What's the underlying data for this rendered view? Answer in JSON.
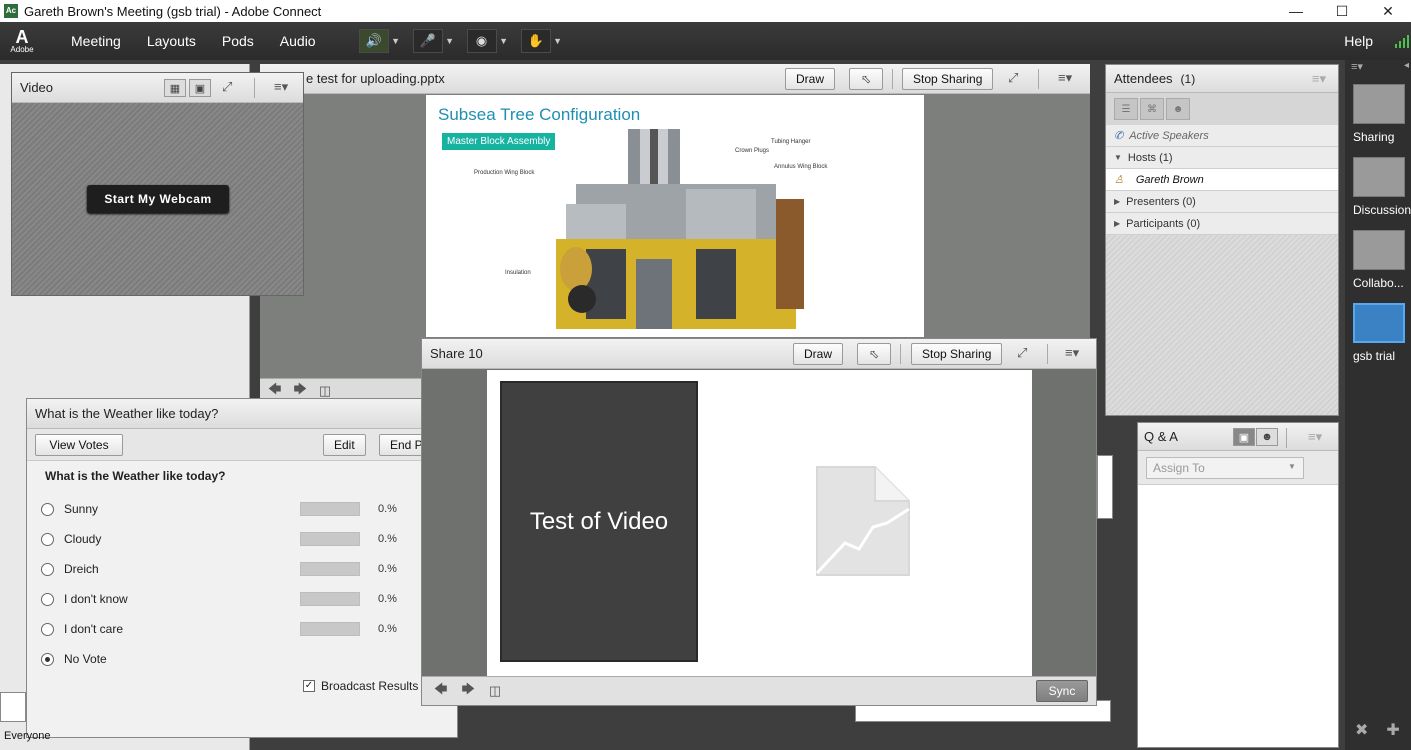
{
  "window": {
    "title": "Gareth  Brown's Meeting (gsb trial) - Adobe Connect",
    "app_icon": "Ac"
  },
  "menubar": {
    "logo_word": "Adobe",
    "logo_mark": "A",
    "items": [
      "Meeting",
      "Layouts",
      "Pods",
      "Audio"
    ],
    "help": "Help"
  },
  "share_pod": {
    "title": "e test for uploading.pptx",
    "draw": "Draw",
    "stop_sharing": "Stop Sharing",
    "slide": {
      "title": "Subsea Tree Configuration",
      "tag": "Master Block Assembly",
      "labels": [
        "Tubing Hanger",
        "Crown Plugs",
        "Production Wing Block",
        "Annulus Wing Block",
        "Insulation"
      ]
    }
  },
  "video_pod": {
    "title": "Video",
    "webcam_button": "Start My Webcam"
  },
  "poll_pod": {
    "title": "What is the Weather like today?",
    "view_votes": "View Votes",
    "edit": "Edit",
    "end": "End P",
    "question": "What is the Weather like today?",
    "options": [
      {
        "label": "Sunny",
        "pct": "0.%",
        "selected": false
      },
      {
        "label": "Cloudy",
        "pct": "0.%",
        "selected": false
      },
      {
        "label": "Dreich",
        "pct": "0.%",
        "selected": false
      },
      {
        "label": "I don't know",
        "pct": "0.%",
        "selected": false
      },
      {
        "label": "I don't care",
        "pct": "0.%",
        "selected": false
      },
      {
        "label": "No Vote",
        "pct": "",
        "selected": true
      }
    ],
    "broadcast": "Broadcast Results"
  },
  "share2": {
    "title": "Share 10",
    "draw": "Draw",
    "stop_sharing": "Stop Sharing",
    "video_slide_text": "Test of Video",
    "sync": "Sync"
  },
  "attendees": {
    "title": "Attendees",
    "count": "(1)",
    "active_speakers": "Active Speakers",
    "hosts": "Hosts (1)",
    "host_name": "Gareth  Brown",
    "presenters": "Presenters (0)",
    "participants": "Participants (0)"
  },
  "qa": {
    "title": "Q & A",
    "assign_placeholder": "Assign To"
  },
  "layouts": [
    "Sharing",
    "Discussion",
    "Collabo...",
    "gsb trial"
  ],
  "chat": {
    "everyone": "Everyone"
  },
  "colors": {
    "accent": "#1f8fb2",
    "tag": "#16b3a0",
    "speaker_active": "#5fd45a",
    "selected_layout": "#3a82c4"
  }
}
